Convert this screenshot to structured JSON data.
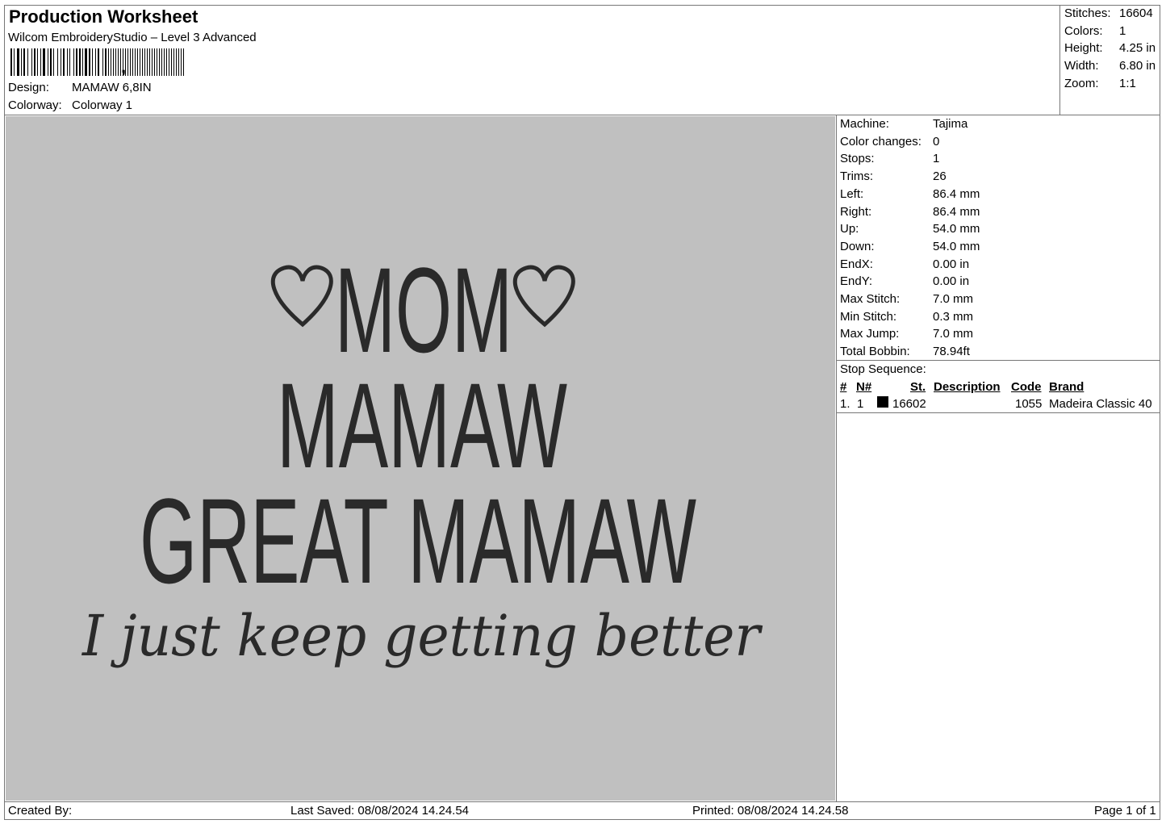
{
  "header": {
    "title": "Production Worksheet",
    "software": "Wilcom EmbroideryStudio – Level 3 Advanced",
    "barcode_suffix": ",",
    "design_label": "Design:",
    "design_value": "MAMAW 6,8IN",
    "colorway_label": "Colorway:",
    "colorway_value": "Colorway 1"
  },
  "summary": {
    "stitches_label": "Stitches:",
    "stitches_value": "16604",
    "colors_label": "Colors:",
    "colors_value": "1",
    "height_label": "Height:",
    "height_value": "4.25 in",
    "width_label": "Width:",
    "width_value": "6.80 in",
    "zoom_label": "Zoom:",
    "zoom_value": "1:1"
  },
  "design_text": {
    "line1": "MOM",
    "line2": "MAMAW",
    "line3": "GREAT MAMAW",
    "line4": "I just keep getting better"
  },
  "machine_info": [
    {
      "label": "Machine:",
      "value": "Tajima"
    },
    {
      "label": "Color changes:",
      "value": "0"
    },
    {
      "label": "Stops:",
      "value": "1"
    },
    {
      "label": "Trims:",
      "value": "26"
    },
    {
      "label": "Left:",
      "value": "86.4 mm"
    },
    {
      "label": "Right:",
      "value": "86.4 mm"
    },
    {
      "label": "Up:",
      "value": "54.0 mm"
    },
    {
      "label": "Down:",
      "value": "54.0 mm"
    },
    {
      "label": "EndX:",
      "value": "0.00 in"
    },
    {
      "label": "EndY:",
      "value": "0.00 in"
    },
    {
      "label": "Max Stitch:",
      "value": "7.0 mm"
    },
    {
      "label": "Min Stitch:",
      "value": "0.3 mm"
    },
    {
      "label": "Max Jump:",
      "value": "7.0 mm"
    },
    {
      "label": "Total Bobbin:",
      "value": "78.94ft"
    }
  ],
  "stop_sequence": {
    "title": "Stop Sequence:",
    "headers": {
      "num": "#",
      "n": "N#",
      "st": "St.",
      "description": "Description",
      "code": "Code",
      "brand": "Brand"
    },
    "rows": [
      {
        "num": "1.",
        "n": "1",
        "swatch_color": "#000000",
        "st": "16602",
        "description": "",
        "code": "1055",
        "brand": "Madeira Classic 40"
      }
    ]
  },
  "footer": {
    "created_by": "Created By:",
    "last_saved": "Last Saved: 08/08/2024 14.24.54",
    "printed": "Printed: 08/08/2024 14.24.58",
    "page": "Page 1 of 1"
  },
  "colors": {
    "preview_bg": "#c0c0c0",
    "thread": "#2a2a2a"
  }
}
